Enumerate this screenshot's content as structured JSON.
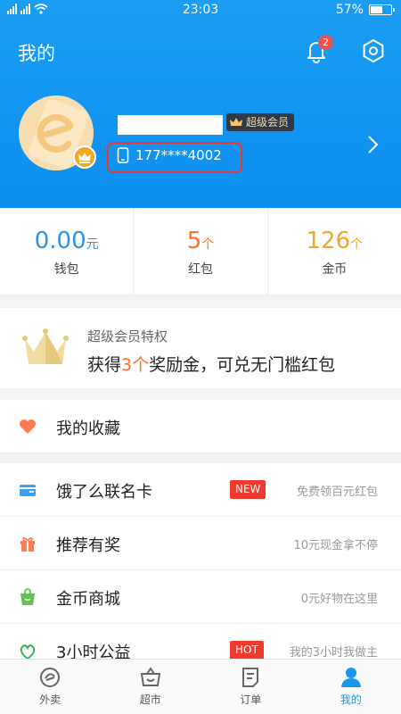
{
  "status_bar": {
    "time": "23:03",
    "battery": "57%"
  },
  "header": {
    "title": "我的",
    "notification_count": "2",
    "vip_label": "超级会员",
    "phone": "177****4002"
  },
  "stats": [
    {
      "value": "0.00",
      "unit": "元",
      "label": "钱包",
      "color": "#2b94e5"
    },
    {
      "value": "5",
      "unit": "个",
      "label": "红包",
      "color": "#ff6f2e"
    },
    {
      "value": "126",
      "unit": "个",
      "label": "金币",
      "color": "#f2a52a"
    }
  ],
  "member": {
    "subtitle": "超级会员特权",
    "text_prefix": "获得",
    "count": "3个",
    "text_suffix": "奖励金，可兑无门槛红包"
  },
  "favorites": {
    "label": "我的收藏"
  },
  "menu": [
    {
      "label": "饿了么联名卡",
      "tag": "NEW",
      "hint": "免费领百元红包",
      "icon": "card-icon"
    },
    {
      "label": "推荐有奖",
      "tag": "",
      "hint": "10元现金拿不停",
      "icon": "gift-icon"
    },
    {
      "label": "金币商城",
      "tag": "",
      "hint": "0元好物在这里",
      "icon": "bag-icon"
    },
    {
      "label": "3小时公益",
      "tag": "HOT",
      "hint": "我的3小时我做主",
      "icon": "charity-icon"
    }
  ],
  "tabbar": [
    {
      "label": "外卖",
      "icon": "takeout-icon"
    },
    {
      "label": "超市",
      "icon": "market-icon"
    },
    {
      "label": "订单",
      "icon": "order-icon"
    },
    {
      "label": "我的",
      "icon": "profile-icon"
    }
  ],
  "colors": {
    "brand": "#0c8ff0",
    "accent": "#ff6f2e",
    "tag": "#f03a2e"
  }
}
